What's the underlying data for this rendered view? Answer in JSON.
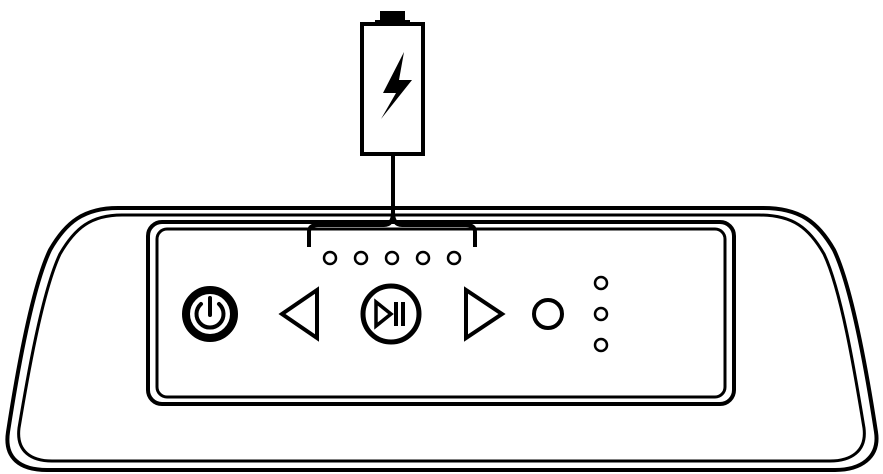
{
  "colors": {
    "stroke": "#000000",
    "background": "#ffffff"
  },
  "battery": {
    "icon": "battery-charging-icon",
    "state": "charging"
  },
  "battery_indicator_leds": {
    "count": 5,
    "lit": 0
  },
  "control_panel": {
    "buttons": [
      {
        "id": "power",
        "icon": "power-icon"
      },
      {
        "id": "previous",
        "icon": "previous-triangle-icon"
      },
      {
        "id": "play-pause",
        "icon": "play-pause-icon"
      },
      {
        "id": "next",
        "icon": "next-triangle-icon"
      },
      {
        "id": "mode",
        "icon": "circle-button-icon"
      }
    ],
    "status_leds": {
      "count": 3,
      "lit": 0
    }
  }
}
